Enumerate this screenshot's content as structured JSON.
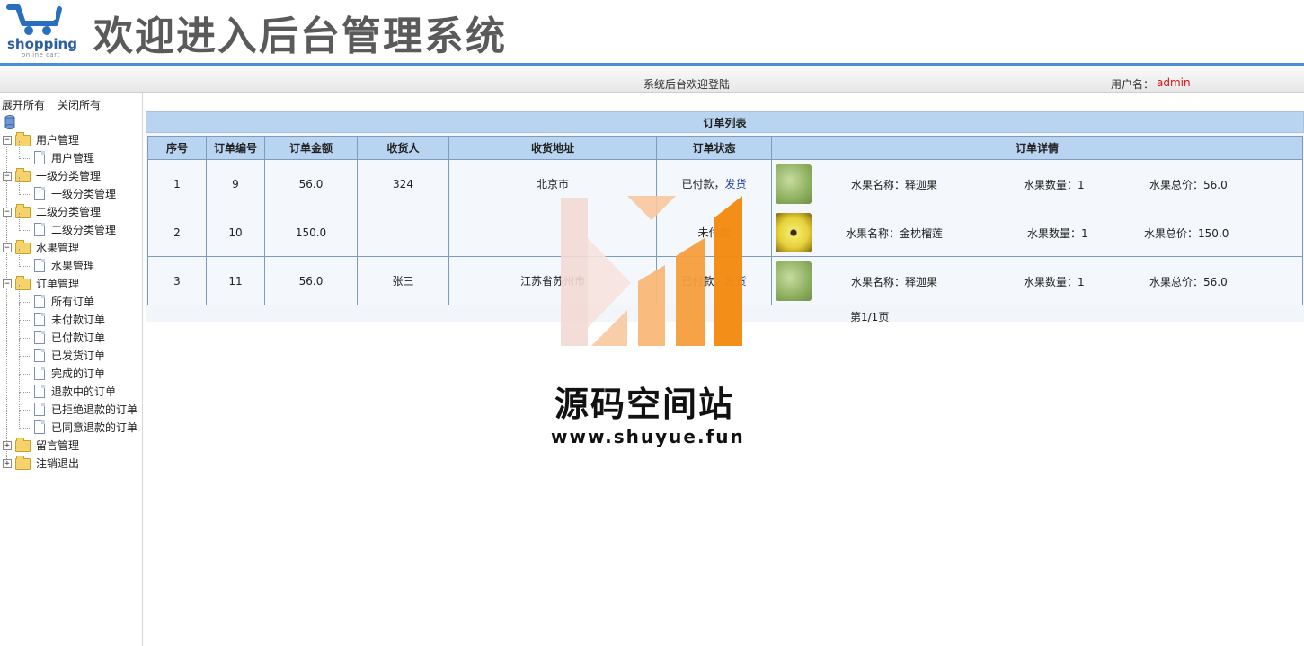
{
  "header": {
    "logo_text": "shopping",
    "logo_sub": "online cart",
    "title": "欢迎进入后台管理系统"
  },
  "topbar": {
    "welcome": "系统后台欢迎登陆",
    "user_label": "用户名：",
    "user_name": "admin"
  },
  "sidebar": {
    "expand_all": "展开所有",
    "close_all": "关闭所有",
    "groups": [
      {
        "label": "用户管理",
        "expanded": true,
        "items": [
          "用户管理"
        ]
      },
      {
        "label": "一级分类管理",
        "expanded": true,
        "items": [
          "一级分类管理"
        ]
      },
      {
        "label": "二级分类管理",
        "expanded": true,
        "items": [
          "二级分类管理"
        ]
      },
      {
        "label": "水果管理",
        "expanded": true,
        "items": [
          "水果管理"
        ]
      },
      {
        "label": "订单管理",
        "expanded": true,
        "items": [
          "所有订单",
          "未付款订单",
          "已付款订单",
          "已发货订单",
          "完成的订单",
          "退款中的订单",
          "已拒绝退款的订单",
          "已同意退款的订单"
        ]
      },
      {
        "label": "留言管理",
        "expanded": false,
        "items": []
      },
      {
        "label": "注销退出",
        "expanded": false,
        "items": []
      }
    ]
  },
  "order_list": {
    "title": "订单列表",
    "headers": [
      "序号",
      "订单编号",
      "订单金额",
      "收货人",
      "收货地址",
      "订单状态",
      "订单详情"
    ],
    "rows": [
      {
        "index": "1",
        "order_no": "9",
        "amount": "56.0",
        "receiver": "324",
        "address": "北京市",
        "status": "已付款，",
        "action": "发货",
        "detail": {
          "name": "水果名称：释迦果",
          "qty": "水果数量：1",
          "total": "水果总价：56.0",
          "thumb": "green-fruit-image"
        }
      },
      {
        "index": "2",
        "order_no": "10",
        "amount": "150.0",
        "receiver": "",
        "address": "",
        "status": "未付款",
        "action": "",
        "detail": {
          "name": "水果名称：金枕榴莲",
          "qty": "水果数量：1",
          "total": "水果总价：150.0",
          "thumb": "yellow-fruit-image"
        }
      },
      {
        "index": "3",
        "order_no": "11",
        "amount": "56.0",
        "receiver": "张三",
        "address": "江苏省苏州市",
        "status": "已付款，",
        "action": "发货",
        "detail": {
          "name": "水果名称：释迦果",
          "qty": "水果数量：1",
          "total": "水果总价：56.0",
          "thumb": "green-fruit-image"
        }
      }
    ],
    "pager": "第1/1页"
  },
  "watermark": {
    "title": "源码空间站",
    "url": "www.shuyue.fun"
  },
  "colors": {
    "accent_blue": "#4a8fd6",
    "table_header": "#b8d4f0",
    "username_red": "#dd1111",
    "link_blue": "#1a3fb3"
  }
}
